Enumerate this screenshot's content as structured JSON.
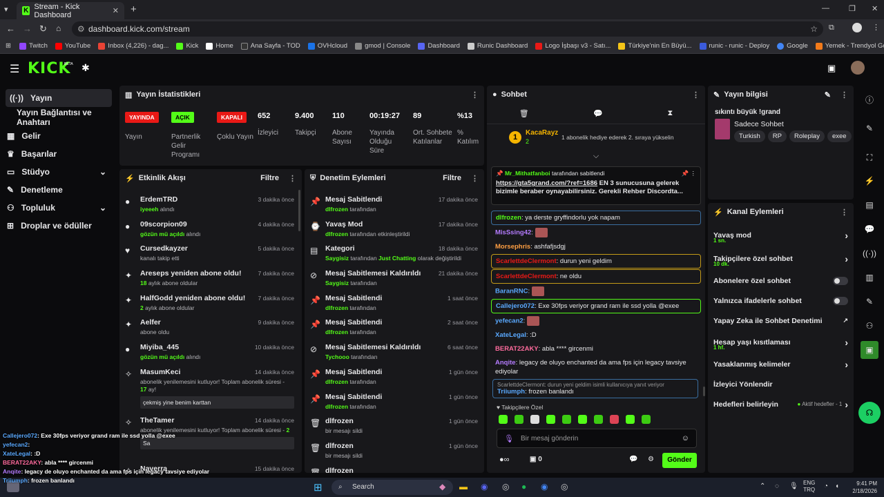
{
  "browser": {
    "tab_title": "Stream - Kick Dashboard",
    "url": "dashboard.kick.com/stream",
    "bookmarks": [
      "Twitch",
      "YouTube",
      "Inbox (4,226) - dag...",
      "Kick",
      "Home",
      "Ana Sayfa - TOD",
      "OVHcloud",
      "gmod | Console",
      "Dashboard",
      "Runic Dashboard",
      "Logo İşbaşı v3 - Satı...",
      "Türkiye'nin En Büyü...",
      "runic - runic - Deploy",
      "Google",
      "Yemek - Trendyol Go"
    ]
  },
  "topnav": {
    "logo": "KICK",
    "beta": "BETA"
  },
  "sidebar": {
    "items": [
      {
        "label": "Yayın"
      },
      {
        "label": "Yayın Bağlantısı ve Anahtarı"
      },
      {
        "label": "Gelir"
      },
      {
        "label": "Başarılar"
      },
      {
        "label": "Stüdyo"
      },
      {
        "label": "Denetleme"
      },
      {
        "label": "Topluluk"
      },
      {
        "label": "Droplar ve ödüller"
      }
    ]
  },
  "stats": {
    "title": "Yayın İstatistikleri",
    "badges": [
      {
        "text": "YAYINDA",
        "label": "Yayın",
        "color": "#e91916"
      },
      {
        "text": "AÇIK",
        "label": "Partnerlik Gelir Programı",
        "color": "#53fc18"
      },
      {
        "text": "KAPALI",
        "label": "Çoklu Yayın",
        "color": "#e91916"
      }
    ],
    "values": [
      {
        "v": "652",
        "l": "İzleyici"
      },
      {
        "v": "9.400",
        "l": "Takipçi"
      },
      {
        "v": "110",
        "l": "Abone Sayısı"
      },
      {
        "v": "00:19:27",
        "l": "Yayında Olduğu Süre"
      },
      {
        "v": "89",
        "l": "Ort. Sohbete Katılanlar"
      },
      {
        "v": "%13",
        "l": "% Katılım"
      }
    ]
  },
  "activity": {
    "title": "Etkinlik Akışı",
    "filter": "Filtre",
    "items": [
      {
        "title": "ErdemTRD",
        "hl": "iyeeeh",
        "sub": " alındı",
        "time": "3 dakika önce",
        "icon": "●"
      },
      {
        "title": "09scorpion09",
        "hl": "gözün mü açıldı",
        "sub": " alındı",
        "time": "4 dakika önce",
        "icon": "●"
      },
      {
        "title": "Cursedkayzer",
        "hl": "",
        "sub": "kanalı takip etti",
        "time": "5 dakika önce",
        "icon": "♥"
      },
      {
        "title": "Areseps yeniden abone oldu!",
        "hl": "18",
        "sub": " aylık abone oldular",
        "time": "7 dakika önce",
        "icon": "✦"
      },
      {
        "title": "HalfGodd yeniden abone oldu!",
        "hl": "2",
        "sub": " aylık abone oldular",
        "time": "7 dakika önce",
        "icon": "✦"
      },
      {
        "title": "Aelfer",
        "hl": "",
        "sub": "abone oldu",
        "time": "9 dakika önce",
        "icon": "✦"
      },
      {
        "title": "Miyiba_445",
        "hl": "gözün mü açıldı",
        "sub": " alındı",
        "time": "10 dakika önce",
        "icon": "●"
      }
    ],
    "gift1": {
      "title": "MasumKeci",
      "sub": "abonelik yenilemesini kutluyor! Toplam abonelik süresi -",
      "months": "17",
      "unit": " ay!",
      "quote": "çekmiş yine benim karttan",
      "time": "14 dakika önce"
    },
    "gift2": {
      "title": "TheTamer",
      "sub": "abonelik yenilemesini kutluyor! Toplam abonelik süresi -",
      "months": "2",
      "unit": "",
      "quote": "Sa",
      "time": "14 dakika önce"
    },
    "last": {
      "title": "Naverra",
      "time": "15 dakika önce"
    }
  },
  "moderation": {
    "title": "Denetim Eylemleri",
    "filter": "Filtre",
    "items": [
      {
        "title": "Mesaj Sabitlendi",
        "hl": "dlfrozen",
        "sub": " tarafından",
        "time": "17 dakika önce",
        "icon": "📌"
      },
      {
        "title": "Yavaş Mod",
        "hl": "dlfrozen",
        "sub": " tarafından etkinleştirildi",
        "time": "17 dakika önce",
        "icon": "⌚"
      },
      {
        "title": "Kategori",
        "hl": "Saygisiz",
        "sub": " tarafından ",
        "hl2": "Just Chatting",
        "sub2": " olarak değiştirildi",
        "time": "18 dakika önce",
        "icon": "▤"
      },
      {
        "title": "Mesaj Sabitlemesi Kaldırıldı",
        "hl": "Saygisiz",
        "sub": " tarafından",
        "time": "21 dakika önce",
        "icon": "⊘"
      },
      {
        "title": "Mesaj Sabitlendi",
        "hl": "dlfrozen",
        "sub": " tarafından",
        "time": "1 saat önce",
        "icon": "📌"
      },
      {
        "title": "Mesaj Sabitlendi",
        "hl": "dlfrozen",
        "sub": " tarafından",
        "time": "2 saat önce",
        "icon": "📌"
      },
      {
        "title": "Mesaj Sabitlemesi Kaldırıldı",
        "hl": "Tychooo",
        "sub": " tarafından",
        "time": "6 saat önce",
        "icon": "⊘"
      },
      {
        "title": "Mesaj Sabitlendi",
        "hl": "dlfrozen",
        "sub": " tarafından",
        "time": "1 gün önce",
        "icon": "📌"
      },
      {
        "title": "Mesaj Sabitlendi",
        "hl": "dlfrozen",
        "sub": " tarafından",
        "time": "1 gün önce",
        "icon": "📌"
      },
      {
        "title": "dlfrozen",
        "hl": "",
        "sub": "bir mesajı sildi",
        "time": "1 gün önce",
        "icon": "🗑"
      },
      {
        "title": "dlfrozen",
        "hl": "",
        "sub": "bir mesajı sildi",
        "time": "1 gün önce",
        "icon": "🗑"
      },
      {
        "title": "dlfrozen",
        "hl": "",
        "sub": "",
        "time": "",
        "icon": "🗑"
      }
    ]
  },
  "chat": {
    "title": "Sohbet",
    "gift_user": "KacaRayz",
    "gift_count": "2",
    "gift_text": "1 abonelik hediye ederek 2. sıraya yükselin",
    "pinned": {
      "user": "Mr_Mithatfanboi",
      "by": " tarafından sabitlendi",
      "link": "https://gta5grand.com/?ref=1686",
      "text": " EN 3 sunucusuna gelerek bizimle beraber oynayabilirsiniz. Gerekli Rehber Discordta..."
    },
    "messages": [
      {
        "user": "dlfrozen",
        "color": "#53fc18",
        "text": "ya derste gryffindorlu yok napam",
        "style": "blue"
      },
      {
        "user": "MisSsing42",
        "color": "#b57cff",
        "text": "",
        "style": ""
      },
      {
        "user": "Morsephris",
        "color": "#ff9f43",
        "text": "ashfafjsdgj",
        "style": ""
      },
      {
        "user": "ScarlettdeClermont",
        "color": "#e91916",
        "text": "durun yeni geldim",
        "style": "gold"
      },
      {
        "user": "ScarlettdeClermont",
        "color": "#e91916",
        "text": "ne oldu",
        "style": "gold"
      },
      {
        "user": "BaranRNC",
        "color": "#5aa9ff",
        "text": "",
        "style": ""
      },
      {
        "user": "Callejero072",
        "color": "#5aa9ff",
        "text": "Exe 30fps veriyor grand ram ile ssd yolla @exee",
        "style": "hl"
      },
      {
        "user": "yefecan2",
        "color": "#5aa9ff",
        "text": "",
        "style": ""
      },
      {
        "user": "XateLegal",
        "color": "#5aa9ff",
        "text": ":D",
        "style": ""
      },
      {
        "user": "BERAT22AKY",
        "color": "#ff6b9d",
        "text": "abla **** gircenmi",
        "style": ""
      },
      {
        "user": "Anqite",
        "color": "#b57cff",
        "text": "legacy de oluyo enchanted da ama fps için legacy tavsiye ediyolar",
        "style": ""
      }
    ],
    "reply": {
      "context": "ScarlettdeClermont: durun yeni geldim isimli kullanıcıya yanıt veriyor",
      "user": "Triiumph",
      "text": "frozen banlandı"
    },
    "followers_only": "Takipçilere Özel",
    "input_placeholder": "Bir mesaj gönderin",
    "count": "0",
    "send": "Gönder"
  },
  "info": {
    "title": "Yayın bilgisi",
    "stream_title": "sıkıntı büyük !grand",
    "category": "Sadece Sohbet",
    "tags": [
      "Turkish",
      "RP",
      "Roleplay",
      "exee"
    ]
  },
  "channel": {
    "title": "Kanal Eylemleri",
    "actions": [
      {
        "label": "Yavaş mod",
        "sub": "1 sn.",
        "kind": "chev"
      },
      {
        "label": "Takipçilere özel sohbet",
        "sub": "10 dk.",
        "kind": "chev"
      },
      {
        "label": "Abonelere özel sohbet",
        "sub": "",
        "kind": "toggle"
      },
      {
        "label": "Yalnızca ifadelerle sohbet",
        "sub": "",
        "kind": "toggle"
      },
      {
        "label": "Yapay Zeka ile Sohbet Denetimi",
        "sub": "",
        "kind": "ext"
      },
      {
        "label": "Hesap yaşı kısıtlaması",
        "sub": "1 hf.",
        "kind": "chev"
      },
      {
        "label": "Yasaklanmış kelimeler",
        "sub": "",
        "kind": "chev"
      },
      {
        "label": "İzleyici Yönlendir",
        "sub": "",
        "kind": "none"
      },
      {
        "label": "Hedefleri belirleyin",
        "sub": "",
        "kind": "goal",
        "extra": "Aktif hedefler - 1"
      }
    ]
  },
  "overlay": [
    {
      "user": "Callejero072",
      "color": "#5aa9ff",
      "text": ": Exe 30fps veriyor grand ram ile ssd yolla @exee"
    },
    {
      "user": "yefecan2",
      "color": "#5aa9ff",
      "text": ":"
    },
    {
      "user": "XateLegal",
      "color": "#5aa9ff",
      "text": ": :D"
    },
    {
      "user": "BERAT22AKY",
      "color": "#ff6b9d",
      "text": ": abla **** gircenmi"
    },
    {
      "user": "Anqite",
      "color": "#b57cff",
      "text": ": legacy de oluyo enchanted da ama fps için legacy tavsiye ediyolar"
    },
    {
      "user": "Triiumph",
      "color": "#5aa9ff",
      "text": ": frozen banlandı"
    }
  ],
  "taskbar": {
    "search": "Search",
    "lang1": "ENG",
    "lang2": "TRQ",
    "time": "9:41 PM",
    "date": "2/18/2026"
  }
}
